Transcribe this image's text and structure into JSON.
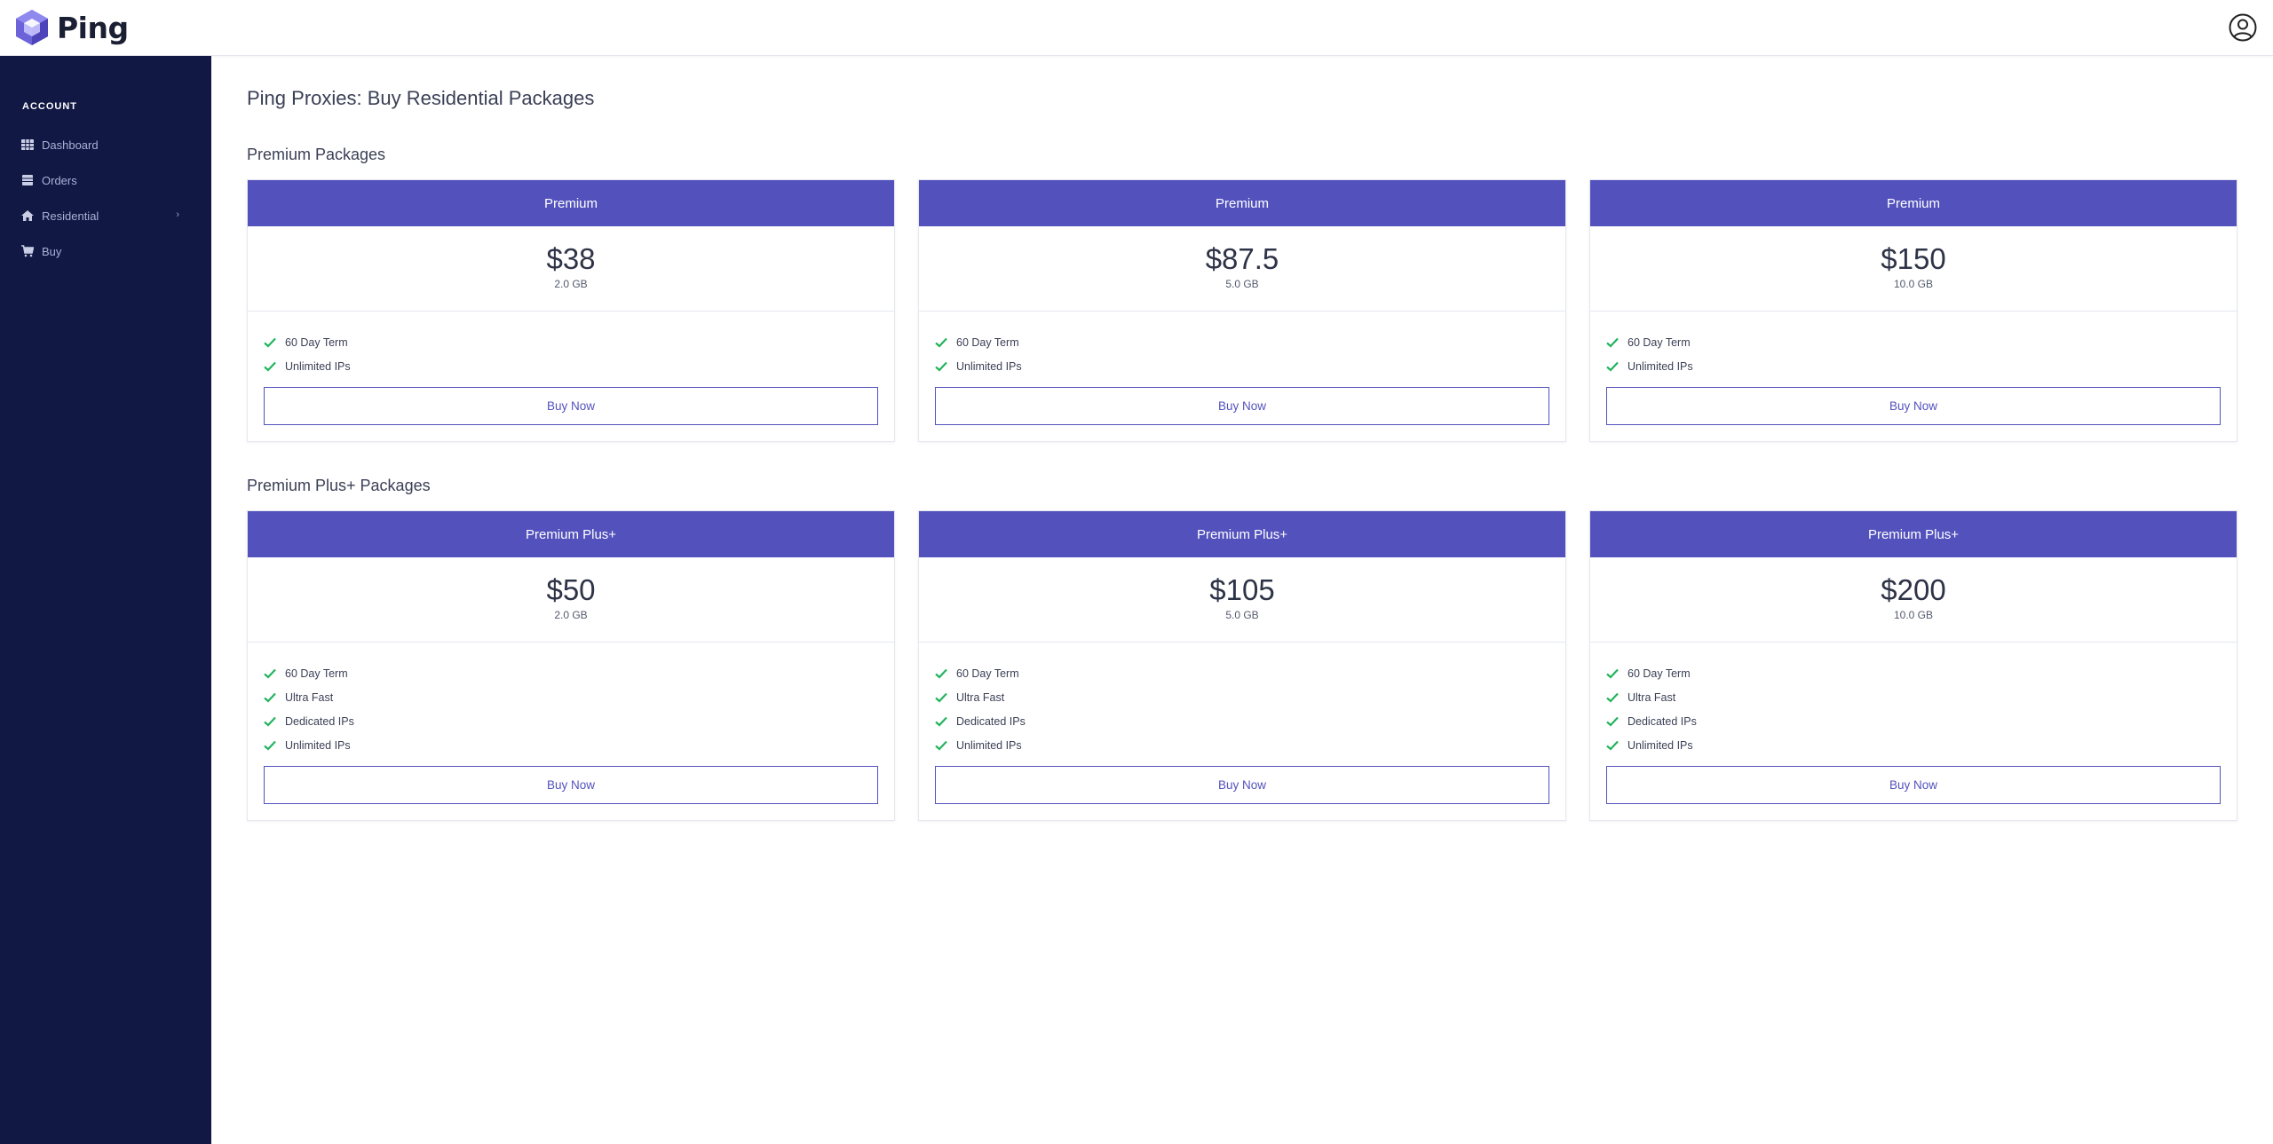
{
  "brand": {
    "name": "Ping"
  },
  "sidebar": {
    "heading": "ACCOUNT",
    "items": [
      {
        "label": "Dashboard",
        "icon": "grid-icon"
      },
      {
        "label": "Orders",
        "icon": "list-icon"
      },
      {
        "label": "Residential",
        "icon": "home-icon",
        "chevron": "›"
      },
      {
        "label": "Buy",
        "icon": "cart-icon"
      }
    ]
  },
  "main": {
    "title": "Ping Proxies: Buy Residential Packages",
    "sections": [
      {
        "title": "Premium Packages",
        "cards": [
          {
            "name": "Premium",
            "price": "$38",
            "size": "2.0 GB",
            "features": [
              "60 Day Term",
              "Unlimited IPs"
            ],
            "button": "Buy Now"
          },
          {
            "name": "Premium",
            "price": "$87.5",
            "size": "5.0 GB",
            "features": [
              "60 Day Term",
              "Unlimited IPs"
            ],
            "button": "Buy Now"
          },
          {
            "name": "Premium",
            "price": "$150",
            "size": "10.0 GB",
            "features": [
              "60 Day Term",
              "Unlimited IPs"
            ],
            "button": "Buy Now"
          }
        ]
      },
      {
        "title": "Premium Plus+ Packages",
        "cards": [
          {
            "name": "Premium Plus+",
            "price": "$50",
            "size": "2.0 GB",
            "features": [
              "60 Day Term",
              "Ultra Fast",
              "Dedicated IPs",
              "Unlimited IPs"
            ],
            "button": "Buy Now"
          },
          {
            "name": "Premium Plus+",
            "price": "$105",
            "size": "5.0 GB",
            "features": [
              "60 Day Term",
              "Ultra Fast",
              "Dedicated IPs",
              "Unlimited IPs"
            ],
            "button": "Buy Now"
          },
          {
            "name": "Premium Plus+",
            "price": "$200",
            "size": "10.0 GB",
            "features": [
              "60 Day Term",
              "Ultra Fast",
              "Dedicated IPs",
              "Unlimited IPs"
            ],
            "button": "Buy Now"
          }
        ]
      }
    ]
  },
  "colors": {
    "accent": "#5352bd",
    "sidebar_bg": "#111843",
    "check": "#22b35e"
  }
}
